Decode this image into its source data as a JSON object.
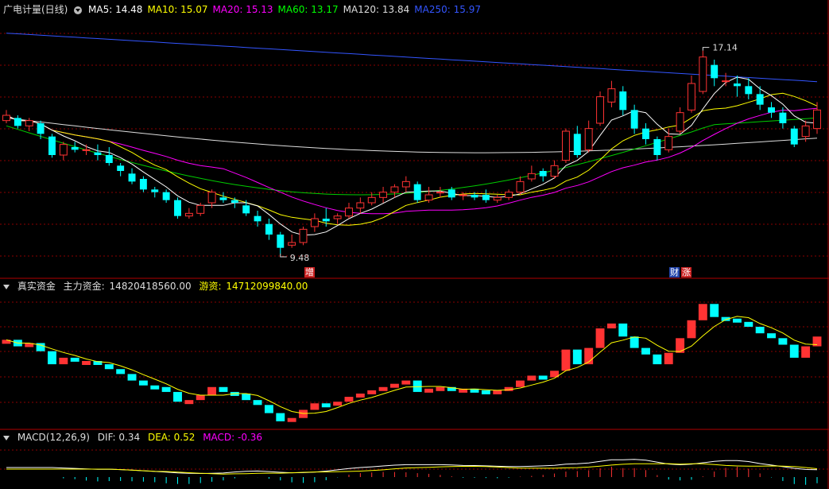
{
  "panel1": {
    "title": "广电计量(日线)",
    "ma": [
      {
        "label": "MA5: 14.48",
        "color": "#ffffff"
      },
      {
        "label": "MA10: 15.07",
        "color": "#ffff00"
      },
      {
        "label": "MA20: 15.13",
        "color": "#ff00ff"
      },
      {
        "label": "MA60: 13.17",
        "color": "#00ff00"
      },
      {
        "label": "MA120: 13.84",
        "color": "#dddddd"
      },
      {
        "label": "MA250: 15.97",
        "color": "#3355ff"
      }
    ],
    "high_label": "17.14",
    "low_label": "9.48",
    "badges": [
      {
        "text": "增",
        "bg": "#cc2222"
      },
      {
        "text": "财",
        "bg": "#2244aa"
      },
      {
        "text": "涨",
        "bg": "#cc2222"
      }
    ]
  },
  "panel2": {
    "title": "真实资金",
    "main_label": "主力资金:",
    "main_value": "14820418560.00",
    "hot_label": "游资:",
    "hot_value": "14712099840.00"
  },
  "panel3": {
    "title": "MACD(12,26,9)",
    "dif": "DIF: 0.34",
    "dea": "DEA: 0.52",
    "macd": "MACD: -0.36"
  },
  "colors": {
    "up": "#ff3333",
    "down": "#00ffff",
    "grid": "#8b0000"
  },
  "chart_data": {
    "type": "candlestick",
    "ylim": [
      9,
      18
    ],
    "candles": [
      [
        14.5,
        14.7,
        14.9,
        14.4
      ],
      [
        14.6,
        14.3,
        14.7,
        14.2
      ],
      [
        14.3,
        14.5,
        14.6,
        14.1
      ],
      [
        14.4,
        14.0,
        14.5,
        13.8
      ],
      [
        13.9,
        13.2,
        14.0,
        13.1
      ],
      [
        13.2,
        13.6,
        13.7,
        13.0
      ],
      [
        13.5,
        13.4,
        13.7,
        13.3
      ],
      [
        13.4,
        13.4,
        13.6,
        13.2
      ],
      [
        13.3,
        13.2,
        13.6,
        13.0
      ],
      [
        13.2,
        12.9,
        13.5,
        12.8
      ],
      [
        12.8,
        12.6,
        12.9,
        12.4
      ],
      [
        12.5,
        12.2,
        12.7,
        12.1
      ],
      [
        12.3,
        11.9,
        12.4,
        11.8
      ],
      [
        11.9,
        11.8,
        12.0,
        11.6
      ],
      [
        11.8,
        11.5,
        11.9,
        11.4
      ],
      [
        11.5,
        10.9,
        11.6,
        10.8
      ],
      [
        10.9,
        11.0,
        11.2,
        10.8
      ],
      [
        11.0,
        11.3,
        11.4,
        10.9
      ],
      [
        11.4,
        11.8,
        11.9,
        11.2
      ],
      [
        11.6,
        11.5,
        11.8,
        11.4
      ],
      [
        11.5,
        11.4,
        11.6,
        11.2
      ],
      [
        11.3,
        11.0,
        11.5,
        10.9
      ],
      [
        10.9,
        10.7,
        11.1,
        10.5
      ],
      [
        10.6,
        10.2,
        10.8,
        10.0
      ],
      [
        10.2,
        9.7,
        10.3,
        9.48
      ],
      [
        9.8,
        9.9,
        10.2,
        9.7
      ],
      [
        9.9,
        10.4,
        10.5,
        9.8
      ],
      [
        10.5,
        10.8,
        11.0,
        10.3
      ],
      [
        10.8,
        10.7,
        11.2,
        10.5
      ],
      [
        10.8,
        10.9,
        11.0,
        10.6
      ],
      [
        10.9,
        11.2,
        11.4,
        10.8
      ],
      [
        11.2,
        11.4,
        11.6,
        11.0
      ],
      [
        11.4,
        11.6,
        11.8,
        11.3
      ],
      [
        11.6,
        11.8,
        12.0,
        11.4
      ],
      [
        11.8,
        12.0,
        12.1,
        11.6
      ],
      [
        12.0,
        12.2,
        12.4,
        11.8
      ],
      [
        12.1,
        11.5,
        12.2,
        11.4
      ],
      [
        11.5,
        11.7,
        12.0,
        11.4
      ],
      [
        11.8,
        11.8,
        12.0,
        11.6
      ],
      [
        11.9,
        11.6,
        12.0,
        11.5
      ],
      [
        11.7,
        11.7,
        11.8,
        11.5
      ],
      [
        11.7,
        11.6,
        11.8,
        11.5
      ],
      [
        11.7,
        11.5,
        11.9,
        11.4
      ],
      [
        11.5,
        11.6,
        11.7,
        11.4
      ],
      [
        11.6,
        11.8,
        11.9,
        11.5
      ],
      [
        11.8,
        12.2,
        12.4,
        11.7
      ],
      [
        12.3,
        12.5,
        12.8,
        12.2
      ],
      [
        12.6,
        12.4,
        12.7,
        12.2
      ],
      [
        12.4,
        12.8,
        13.0,
        12.3
      ],
      [
        13.0,
        14.1,
        14.2,
        12.9
      ],
      [
        14.0,
        13.2,
        14.3,
        13.1
      ],
      [
        13.4,
        14.2,
        14.5,
        13.3
      ],
      [
        14.4,
        15.4,
        15.6,
        14.3
      ],
      [
        15.2,
        15.7,
        16.0,
        15.0
      ],
      [
        15.6,
        14.9,
        15.8,
        14.7
      ],
      [
        14.9,
        14.2,
        15.1,
        14.0
      ],
      [
        14.2,
        13.8,
        14.4,
        13.6
      ],
      [
        13.8,
        13.2,
        13.9,
        13.0
      ],
      [
        13.4,
        13.9,
        14.2,
        13.3
      ],
      [
        14.1,
        14.8,
        15.0,
        14.0
      ],
      [
        14.9,
        15.9,
        16.2,
        14.8
      ],
      [
        15.6,
        16.9,
        17.14,
        15.5
      ],
      [
        16.6,
        16.1,
        16.8,
        15.8
      ],
      [
        16.0,
        16.0,
        16.3,
        15.8
      ],
      [
        15.9,
        15.8,
        16.2,
        15.4
      ],
      [
        15.8,
        15.5,
        16.1,
        15.3
      ],
      [
        15.5,
        15.1,
        15.8,
        14.9
      ],
      [
        15.0,
        14.8,
        15.2,
        14.6
      ],
      [
        14.8,
        14.4,
        15.0,
        14.2
      ],
      [
        14.2,
        13.6,
        14.3,
        13.5
      ],
      [
        13.9,
        14.3,
        14.5,
        13.7
      ],
      [
        14.2,
        14.9,
        15.2,
        14.0
      ]
    ],
    "ma5_end": 14.48,
    "ma10_end": 15.07,
    "ma20_end": 15.13,
    "ma60_end": 13.17,
    "ma120_end": 13.84,
    "ma250_end": 15.97
  }
}
